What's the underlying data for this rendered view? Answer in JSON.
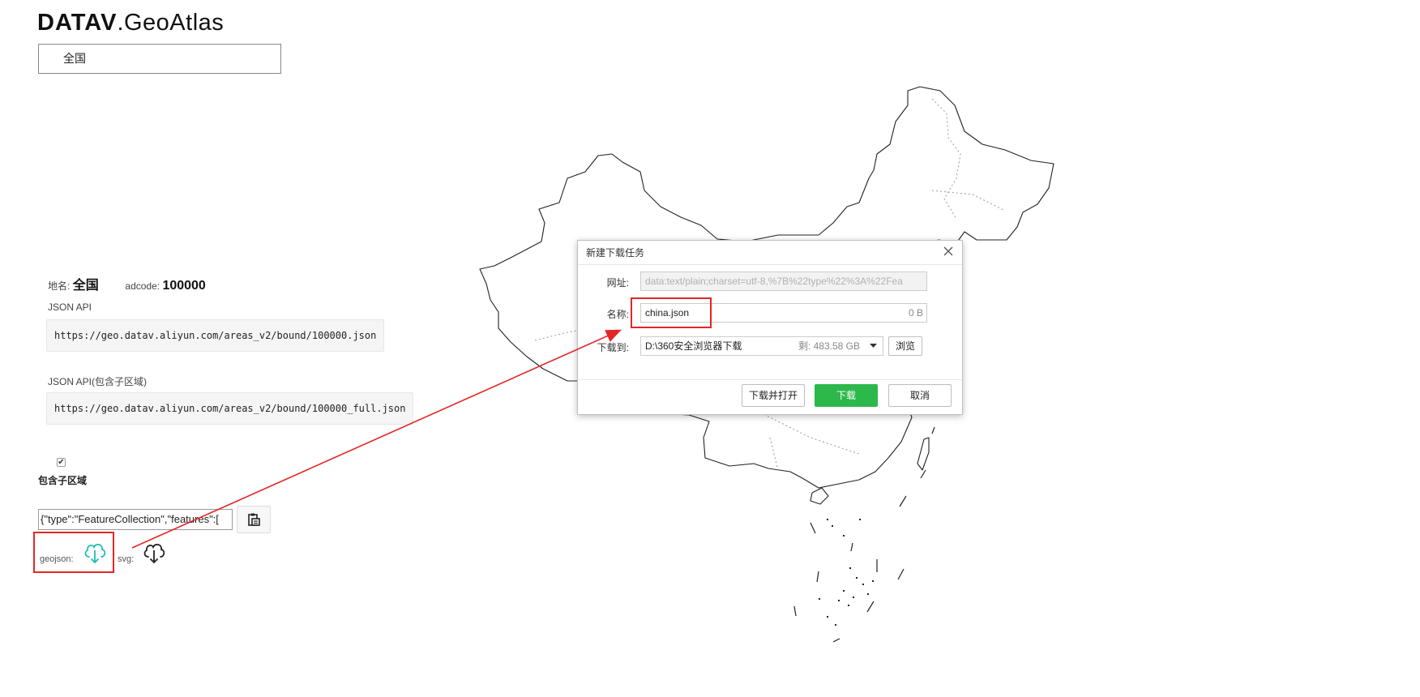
{
  "header": {
    "logo_bold": "DATAV",
    "logo_light": ".GeoAtlas"
  },
  "region_select": {
    "value": "全国"
  },
  "info": {
    "name_label": "地名:",
    "name_value": "全国",
    "adcode_label": "adcode:",
    "adcode_value": "100000"
  },
  "api": {
    "label": "JSON API",
    "url": "https://geo.datav.aliyun.com/areas_v2/bound/100000.json",
    "full_label": "JSON API(包含子区域)",
    "full_url": "https://geo.datav.aliyun.com/areas_v2/bound/100000_full.json"
  },
  "include_children": {
    "checked": true,
    "label": "包含子区域"
  },
  "json_output": {
    "value": "{\"type\":\"FeatureCollection\",\"features\":["
  },
  "downloads": {
    "geojson_label": "geojson:",
    "svg_label": "svg:"
  },
  "colors": {
    "teal": "#1cbfb0",
    "red": "#e32626",
    "green": "#2cb84b"
  },
  "dialog": {
    "title": "新建下载任务",
    "url_label": "网址:",
    "url_value": "data:text/plain;charset=utf-8,%7B%22type%22%3A%22Fea",
    "name_label": "名称:",
    "name_value": "china.json",
    "size": "0 B",
    "dir_label": "下载到:",
    "dir_value": "D:\\360安全浏览器下载",
    "free_space": "剩: 483.58 GB",
    "browse": "浏览",
    "download_open": "下载并打开",
    "download": "下载",
    "cancel": "取消"
  }
}
